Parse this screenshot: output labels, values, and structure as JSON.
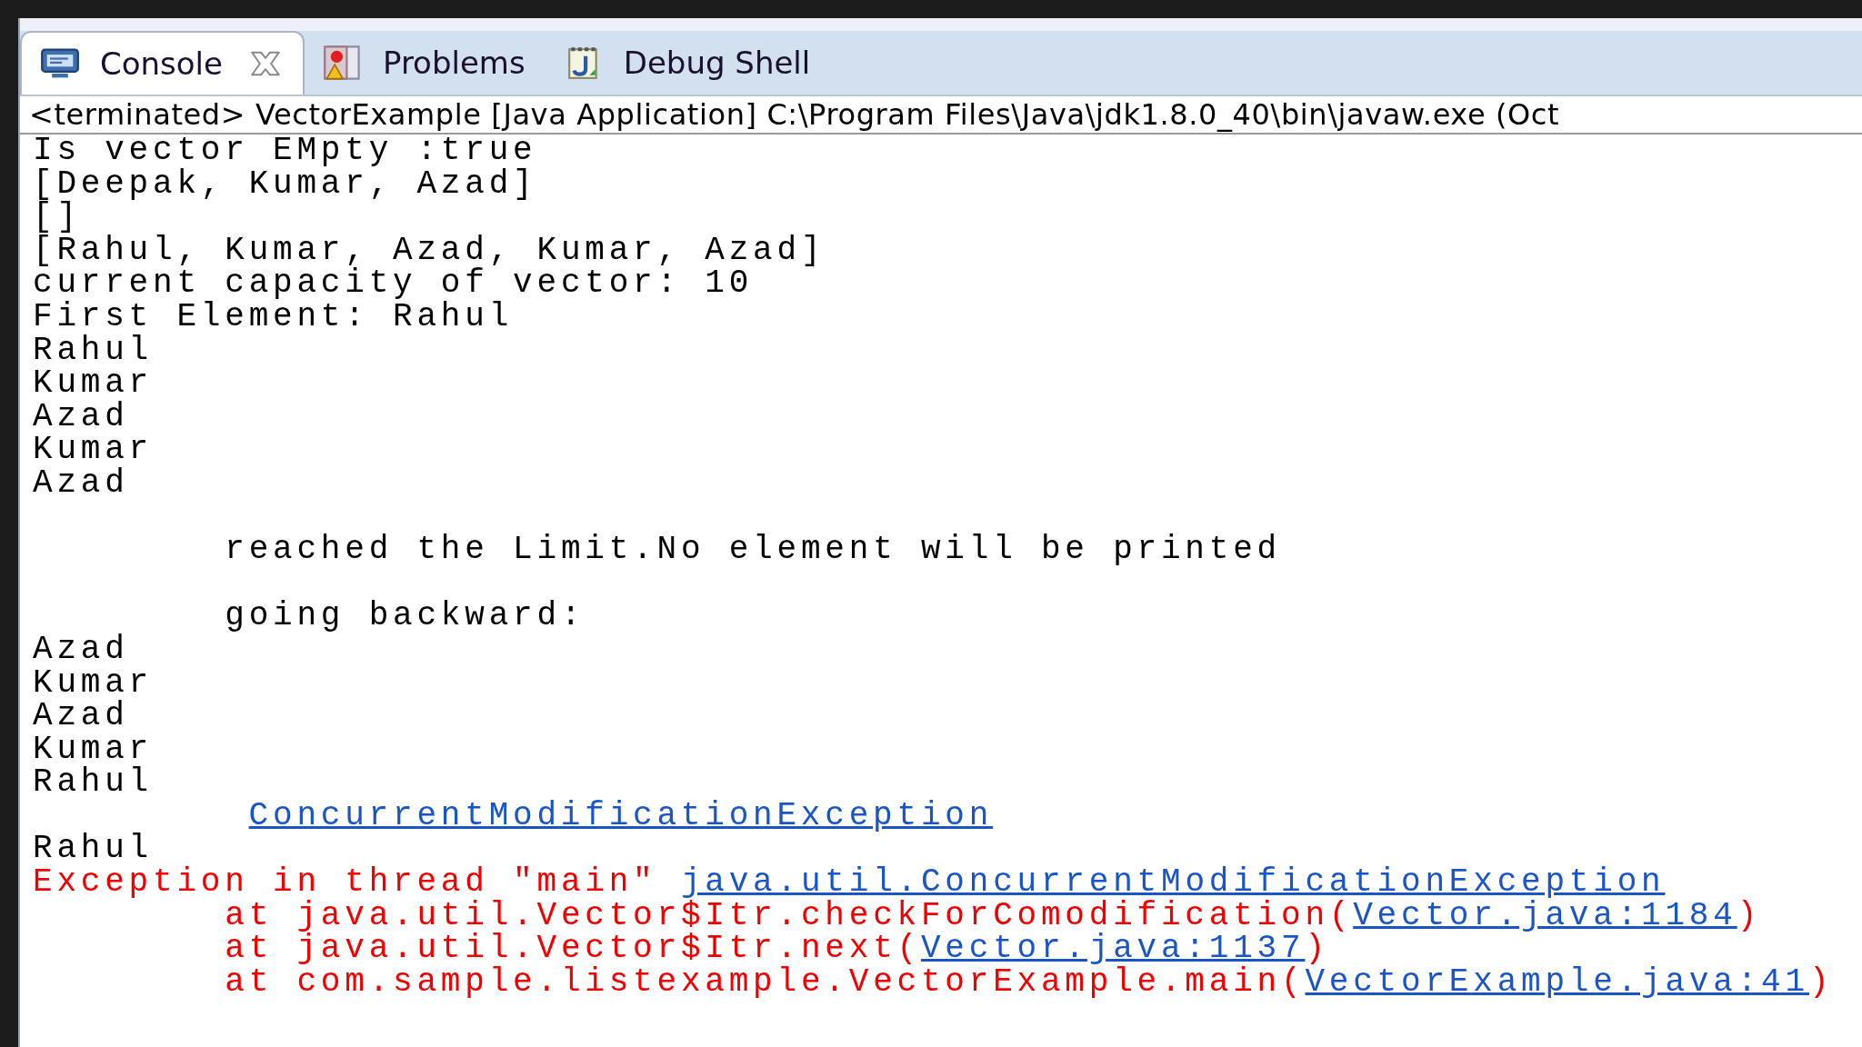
{
  "tabs": [
    {
      "label": "Console",
      "kind": "console",
      "selected": true,
      "closable": true
    },
    {
      "label": "Problems",
      "kind": "problems",
      "selected": false,
      "closable": false
    },
    {
      "label": "Debug Shell",
      "kind": "shell",
      "selected": false,
      "closable": false
    }
  ],
  "process_line": "<terminated> VectorExample [Java Application] C:\\Program Files\\Java\\jdk1.8.0_40\\bin\\javaw.exe (Oct",
  "console_lines": [
    {
      "kind": "text",
      "segments": [
        {
          "kind": "out",
          "text": "Is vector EMpty :true"
        }
      ]
    },
    {
      "kind": "text",
      "segments": [
        {
          "kind": "out",
          "text": "[Deepak, Kumar, Azad]"
        }
      ]
    },
    {
      "kind": "text",
      "segments": [
        {
          "kind": "out",
          "text": "[]"
        }
      ]
    },
    {
      "kind": "text",
      "segments": [
        {
          "kind": "out",
          "text": "[Rahul, Kumar, Azad, Kumar, Azad]"
        }
      ]
    },
    {
      "kind": "text",
      "segments": [
        {
          "kind": "out",
          "text": "current capacity of vector: 10"
        }
      ]
    },
    {
      "kind": "text",
      "segments": [
        {
          "kind": "out",
          "text": "First Element: Rahul"
        }
      ]
    },
    {
      "kind": "text",
      "segments": [
        {
          "kind": "out",
          "text": "Rahul"
        }
      ]
    },
    {
      "kind": "text",
      "segments": [
        {
          "kind": "out",
          "text": "Kumar"
        }
      ]
    },
    {
      "kind": "text",
      "segments": [
        {
          "kind": "out",
          "text": "Azad"
        }
      ]
    },
    {
      "kind": "text",
      "segments": [
        {
          "kind": "out",
          "text": "Kumar"
        }
      ]
    },
    {
      "kind": "text",
      "segments": [
        {
          "kind": "out",
          "text": "Azad"
        }
      ]
    },
    {
      "kind": "blank"
    },
    {
      "kind": "text",
      "segments": [
        {
          "kind": "out",
          "text": "\treached the Limit.No element will be printed"
        }
      ]
    },
    {
      "kind": "blank"
    },
    {
      "kind": "text",
      "segments": [
        {
          "kind": "out",
          "text": "\tgoing backward:"
        }
      ]
    },
    {
      "kind": "text",
      "segments": [
        {
          "kind": "out",
          "text": "Azad"
        }
      ]
    },
    {
      "kind": "text",
      "segments": [
        {
          "kind": "out",
          "text": "Kumar"
        }
      ]
    },
    {
      "kind": "text",
      "segments": [
        {
          "kind": "out",
          "text": "Azad"
        }
      ]
    },
    {
      "kind": "text",
      "segments": [
        {
          "kind": "out",
          "text": "Kumar"
        }
      ]
    },
    {
      "kind": "text",
      "segments": [
        {
          "kind": "out",
          "text": "Rahul"
        }
      ]
    },
    {
      "kind": "indented",
      "segments": [
        {
          "kind": "link",
          "text": "ConcurrentModificationException"
        }
      ]
    },
    {
      "kind": "text",
      "segments": [
        {
          "kind": "out",
          "text": "Rahul"
        }
      ]
    },
    {
      "kind": "text",
      "segments": [
        {
          "kind": "err",
          "text": "Exception in thread \"main\" "
        },
        {
          "kind": "link",
          "text": "java.util.ConcurrentModificationException"
        }
      ]
    },
    {
      "kind": "text",
      "segments": [
        {
          "kind": "err",
          "text": "\tat java.util.Vector$Itr.checkForComodification("
        },
        {
          "kind": "link",
          "text": "Vector.java:1184"
        },
        {
          "kind": "err",
          "text": ")"
        }
      ]
    },
    {
      "kind": "text",
      "segments": [
        {
          "kind": "err",
          "text": "\tat java.util.Vector$Itr.next("
        },
        {
          "kind": "link",
          "text": "Vector.java:1137"
        },
        {
          "kind": "err",
          "text": ")"
        }
      ]
    },
    {
      "kind": "text",
      "segments": [
        {
          "kind": "err",
          "text": "\tat com.sample.listexample.VectorExample.main("
        },
        {
          "kind": "link",
          "text": "VectorExample.java:41"
        },
        {
          "kind": "err",
          "text": ")"
        }
      ]
    }
  ]
}
